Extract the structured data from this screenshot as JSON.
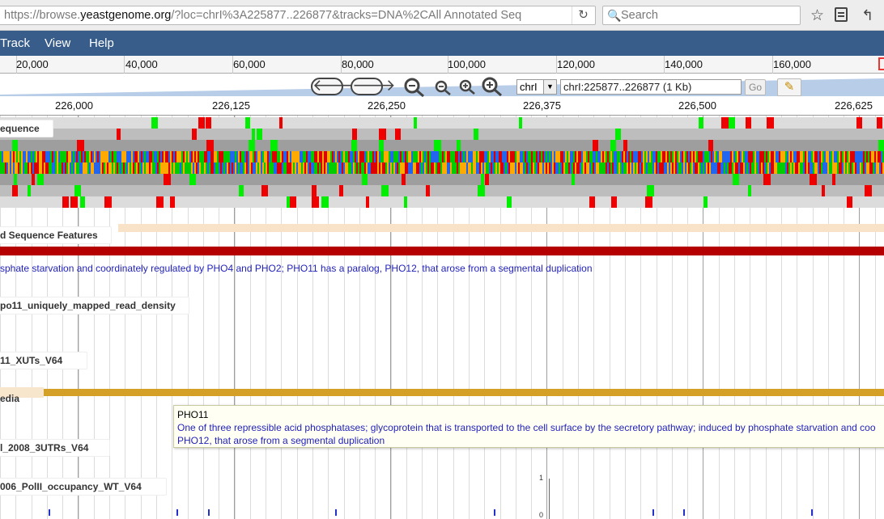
{
  "browser": {
    "url_prefix": "https://browse.",
    "url_host": "yeastgenome.org",
    "url_rest": "/?loc=chrI%3A225877..226877&tracks=DNA%2CAll Annotated Seq",
    "search_placeholder": "Search",
    "reload_glyph": "↻",
    "search_glyph": "🔍",
    "star_glyph": "☆",
    "back_glyph": "↰"
  },
  "menubar": {
    "items": [
      "Track",
      "View",
      "Help"
    ]
  },
  "overview": {
    "labels": [
      "20,000",
      "40,000",
      "60,000",
      "80,000",
      "100,000",
      "120,000",
      "140,000",
      "160,000"
    ]
  },
  "nav": {
    "back_arrow": "🡐",
    "forward_arrow": "🡒",
    "chrom_value": "chrI",
    "dropdown_glyph": "▼",
    "location_value": "chrI:225877..226877 (1 Kb)",
    "go_label": "Go",
    "highlight_glyph": "✎"
  },
  "scale": {
    "labels": [
      "226,000",
      "226,125",
      "226,250",
      "226,375",
      "226,500",
      "226,625"
    ]
  },
  "tracks": {
    "reference_sequence_label": "equence",
    "annotated_features_label": "d Sequence Features",
    "pho11_description": "sphate starvation and coordinately regulated by PHO4 and PHO2; PHO11 has a paralog, PHO12, that arose from a segmental duplication",
    "spo11_label": "po11_uniquely_mapped_read_density",
    "xuts_label": "11_XUTs_V64",
    "media_label": "edia",
    "utrs_label": "l_2008_3UTRs_V64",
    "polII_label": "006_PolII_occupancy_WT_V64",
    "yaxis_top": "1",
    "yaxis_bottom": "0"
  },
  "tooltip": {
    "title": "PHO11",
    "line1": "One of three repressible acid phosphatases; glycoprotein that is transported to the cell surface by the secretory pathway; induced by phosphate starvation and coo",
    "line2": "PHO12, that arose from a segmental duplication"
  },
  "colors": {
    "menubar": "#385d8a",
    "base_A": "#00cc00",
    "base_C": "#2266ee",
    "base_G": "#ffaa00",
    "base_T": "#dd0000",
    "stop_codon": "#ee0000",
    "start_codon": "#00ee00",
    "pho11_feature": "#b40000",
    "media_feature": "#d5a028"
  }
}
